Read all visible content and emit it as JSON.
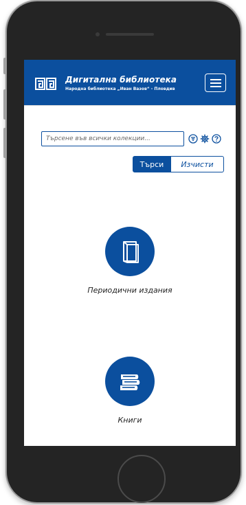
{
  "header": {
    "title": "Дигитална библиотека",
    "subtitle": "Народна библиотека „Иван Вазов“ - Пловдив",
    "menu_label": ""
  },
  "search": {
    "placeholder": "Търсене във всички колекции...",
    "value": "",
    "search_button": "Търси",
    "clear_button": "Изчисти"
  },
  "collections": [
    {
      "label": "Периодични издания",
      "icon": "journal-icon"
    },
    {
      "label": "Книги",
      "icon": "books-stack-icon"
    }
  ],
  "colors": {
    "primary": "#0b4f9e",
    "frame": "#242424"
  }
}
